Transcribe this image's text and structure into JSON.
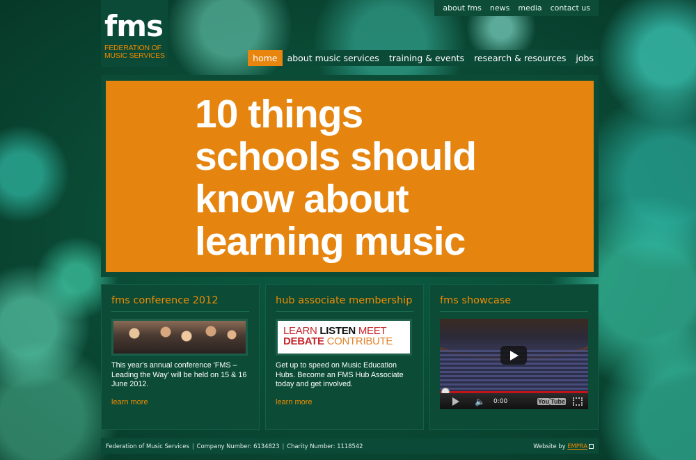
{
  "logo": {
    "mark": "fms",
    "line1": "FEDERATION OF",
    "line2": "MUSIC SERVICES"
  },
  "util_nav": [
    "about fms",
    "news",
    "media",
    "contact us"
  ],
  "main_nav": [
    {
      "label": "home",
      "active": true
    },
    {
      "label": "about music services",
      "active": false
    },
    {
      "label": "training & events",
      "active": false
    },
    {
      "label": "research & resources",
      "active": false
    },
    {
      "label": "jobs",
      "active": false
    }
  ],
  "hero": {
    "lines": [
      "10 things",
      "schools should",
      "know about",
      "learning music"
    ]
  },
  "boxes": {
    "conference": {
      "title": "fms conference 2012",
      "text": "This year's annual conference 'FMS – Leading the Way' will be held on 15 & 16 June 2012.",
      "link": "learn more"
    },
    "hub": {
      "title": "hub associate membership",
      "banner_words": [
        "LEARN",
        "LISTEN",
        "MEET",
        "DEBATE",
        "CONTRIBUTE"
      ],
      "text": "Get up to speed on Music Education Hubs. Become an FMS Hub Associate today and get involved.",
      "link": "learn more"
    },
    "showcase": {
      "title": "fms showcase",
      "video_time": "0:00",
      "video_logo_a": "You",
      "video_logo_b": "Tube"
    }
  },
  "footer": {
    "org": "Federation of Music Services",
    "company": "Company Number: 6134823",
    "charity": "Charity Number: 1118542",
    "credit_prefix": "Website by",
    "credit_link": "EMPRA"
  },
  "colors": {
    "accent": "#e8850f",
    "panel": "#0b4a36"
  }
}
